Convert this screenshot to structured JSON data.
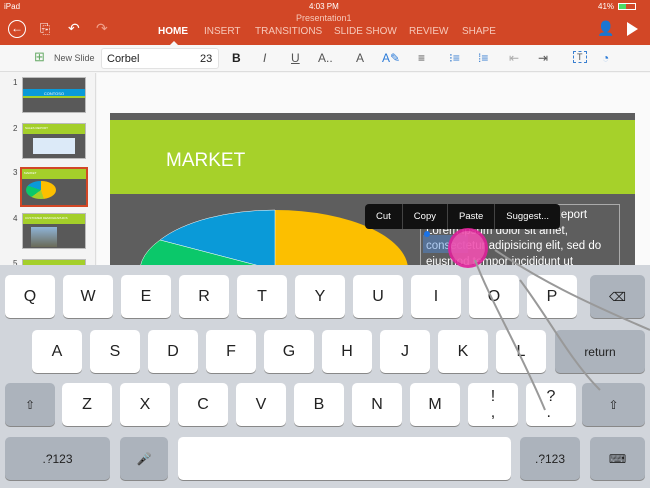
{
  "status": {
    "device": "iPad",
    "time": "4:03 PM",
    "battery": "41%"
  },
  "title": "Presentation1",
  "tabs": [
    "HOME",
    "INSERT",
    "TRANSITIONS",
    "SLIDE SHOW",
    "REVIEW",
    "SHAPE"
  ],
  "ribbon": {
    "new_slide": "New Slide",
    "font": "Corbel",
    "size": "23",
    "bold": "B",
    "italic": "I",
    "underline": "U",
    "more": "A..",
    "font_color": "A"
  },
  "thumbnails": [
    {
      "n": "1",
      "title": "CONTOSO"
    },
    {
      "n": "2",
      "title": "SALES REPORT"
    },
    {
      "n": "3",
      "title": "MARKET"
    },
    {
      "n": "4",
      "title": "CUSTOMER DEMOGRAPHICS"
    },
    {
      "n": "5",
      "title": ""
    }
  ],
  "slide": {
    "title": "MARKET",
    "text": [
      "Contoso Regional Sales Report",
      "Lorem ipsum dolor sit amet,",
      "consectetur adipisicing elit, sed do",
      "eiusmod tempor incididunt ut"
    ],
    "pie_colors": [
      "#fcbf00",
      "#0a9ad8",
      "#0bc86a",
      "#a4cf2a"
    ]
  },
  "context_menu": [
    "Cut",
    "Copy",
    "Paste",
    "Suggest..."
  ],
  "keyboard": {
    "row1": [
      "Q",
      "W",
      "E",
      "R",
      "T",
      "Y",
      "U",
      "I",
      "O",
      "P"
    ],
    "row2": [
      "A",
      "S",
      "D",
      "F",
      "G",
      "H",
      "J",
      "K",
      "L"
    ],
    "row3": [
      "Z",
      "X",
      "C",
      "V",
      "B",
      "N",
      "M",
      "!\n,",
      "?\n."
    ],
    "return": "return",
    "numbers": ".?123"
  },
  "accent": "#d24726"
}
